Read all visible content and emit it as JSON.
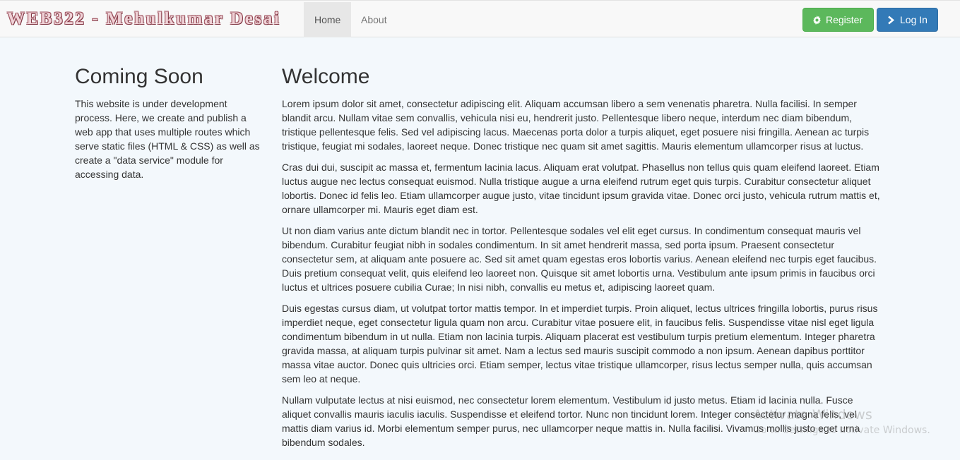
{
  "navbar": {
    "brand": "WEB322 - Mehulkumar Desai",
    "links": [
      {
        "label": "Home",
        "active": true
      },
      {
        "label": "About",
        "active": false
      }
    ],
    "register_label": "Register",
    "login_label": "Log In",
    "register_icon": "gear-icon",
    "login_icon": "chevron-right-icon"
  },
  "sidebar": {
    "title": "Coming Soon",
    "text": "This website is under development process. Here, we create and publish a web app that uses multiple routes which serve static files (HTML & CSS) as well as create a \"data service\" module for accessing data."
  },
  "main": {
    "title": "Welcome",
    "paragraphs": [
      "Lorem ipsum dolor sit amet, consectetur adipiscing elit. Aliquam accumsan libero a sem venenatis pharetra. Nulla facilisi. In semper blandit arcu. Nullam vitae sem convallis, vehicula nisi eu, hendrerit justo. Pellentesque libero neque, interdum nec diam bibendum, tristique pellentesque felis. Sed vel adipiscing lacus. Maecenas porta dolor a turpis aliquet, eget posuere nisi fringilla. Aenean ac turpis tristique, feugiat mi sodales, laoreet neque. Donec tristique nec quam sit amet sagittis. Mauris elementum ullamcorper risus at luctus.",
      "Cras dui dui, suscipit ac massa et, fermentum lacinia lacus. Aliquam erat volutpat. Phasellus non tellus quis quam eleifend laoreet. Etiam luctus augue nec lectus consequat euismod. Nulla tristique augue a urna eleifend rutrum eget quis turpis. Curabitur consectetur aliquet lobortis. Donec id felis leo. Etiam ullamcorper augue justo, vitae tincidunt ipsum gravida vitae. Donec orci justo, vehicula rutrum mattis et, ornare ullamcorper mi. Mauris eget diam est.",
      "Ut non diam varius ante dictum blandit nec in tortor. Pellentesque sodales vel elit eget cursus. In condimentum consequat mauris vel bibendum. Curabitur feugiat nibh in sodales condimentum. In sit amet hendrerit massa, sed porta ipsum. Praesent consectetur consectetur sem, at aliquam ante posuere ac. Sed sit amet quam egestas eros lobortis varius. Aenean eleifend nec turpis eget faucibus. Duis pretium consequat velit, quis eleifend leo laoreet non. Quisque sit amet lobortis urna. Vestibulum ante ipsum primis in faucibus orci luctus et ultrices posuere cubilia Curae; In nisi nibh, convallis eu metus et, adipiscing laoreet quam.",
      "Duis egestas cursus diam, ut volutpat tortor mattis tempor. In et imperdiet turpis. Proin aliquet, lectus ultrices fringilla lobortis, purus risus imperdiet neque, eget consectetur ligula quam non arcu. Curabitur vitae posuere elit, in faucibus felis. Suspendisse vitae nisl eget ligula condimentum bibendum in ut nulla. Etiam non lacinia turpis. Aliquam placerat est vestibulum turpis pretium elementum. Integer pharetra gravida massa, at aliquam turpis pulvinar sit amet. Nam a lectus sed mauris suscipit commodo a non ipsum. Aenean dapibus porttitor massa vitae auctor. Donec quis ultricies orci. Etiam semper, lectus vitae tristique ullamcorper, risus lectus semper nulla, quis accumsan sem leo at neque.",
      "Nullam vulputate lectus at nisi euismod, nec consectetur lorem elementum. Vestibulum id justo metus. Etiam id lacinia nulla. Fusce aliquet convallis mauris iaculis iaculis. Suspendisse et eleifend tortor. Nunc non tincidunt lorem. Integer consectetur magna felis, vel mattis diam varius id. Morbi elementum semper purus, nec ullamcorper neque mattis in. Nulla facilisi. Vivamus mollis justo eget urna bibendum sodales."
    ]
  },
  "watermark": {
    "line1": "Activate Windows",
    "line2": "Go to Settings to activate Windows."
  },
  "colors": {
    "page_bg": "#f3f8fc",
    "navbar_bg": "#f8f8f8",
    "register_bg": "#5cb85c",
    "login_bg": "#337ab7"
  }
}
